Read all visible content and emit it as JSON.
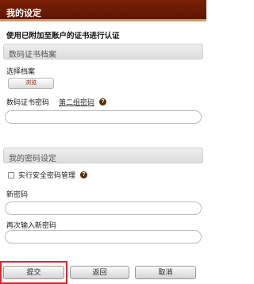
{
  "header": {
    "title": "我的设定"
  },
  "intro_text": "使用已附加至账户的证书进行认证",
  "certificate_section": {
    "title": "数码证书档案",
    "select_file_label": "选择档案",
    "browse_button": "浏览",
    "password_label": "数码证书密码",
    "second_password_link": "第二组密码",
    "help_icon": "?",
    "password_value": ""
  },
  "password_section": {
    "title": "我的密码设定",
    "checkbox_label": "实行安全密码管理",
    "checkbox_checked": false,
    "help_icon": "?",
    "new_password_label": "新密码",
    "new_password_value": "",
    "confirm_password_label": "再次输入新密码",
    "confirm_password_value": ""
  },
  "footer": {
    "submit_label": "提交",
    "back_label": "返回",
    "cancel_label": "取消"
  },
  "colors": {
    "header_bg": "#6b1a03",
    "header_accent": "#c49a64",
    "highlight": "#e0252b"
  }
}
